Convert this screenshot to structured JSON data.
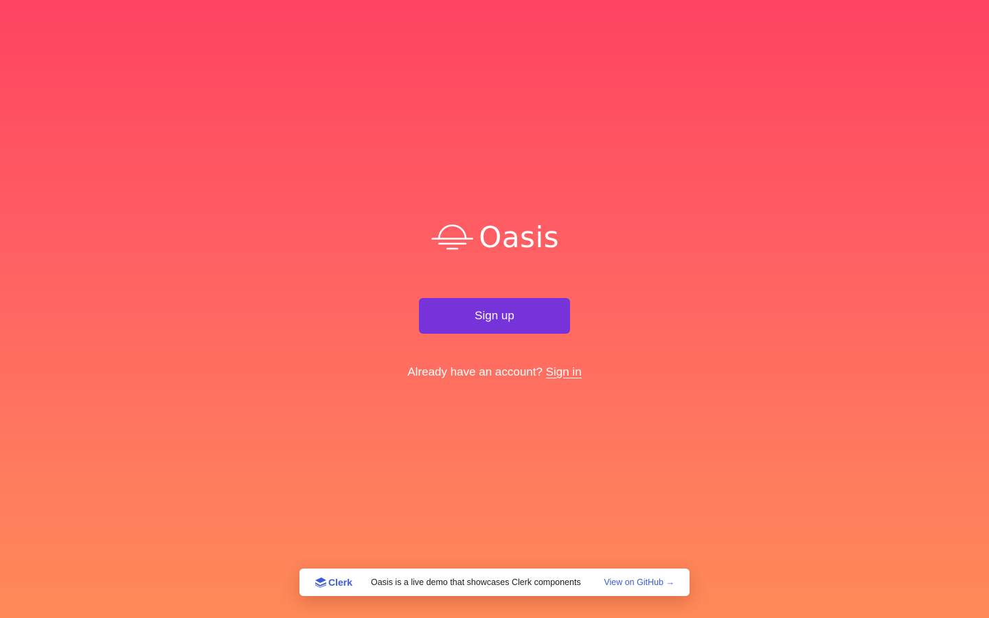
{
  "app": {
    "name": "Oasis"
  },
  "actions": {
    "signup_label": "Sign up",
    "signin_prompt": "Already have an account?",
    "signin_label": "Sign in"
  },
  "banner": {
    "brand": "Clerk",
    "message": "Oasis is a live demo that showcases Clerk components",
    "github_label": "View on GitHub →"
  },
  "colors": {
    "gradient_top": "#ff4361",
    "gradient_bottom": "#ff8a58",
    "primary_button": "#7633d9",
    "link_blue": "#3b5bdb"
  },
  "icons": {
    "logo": "sunset-icon",
    "brand": "clerk-logo-icon"
  }
}
